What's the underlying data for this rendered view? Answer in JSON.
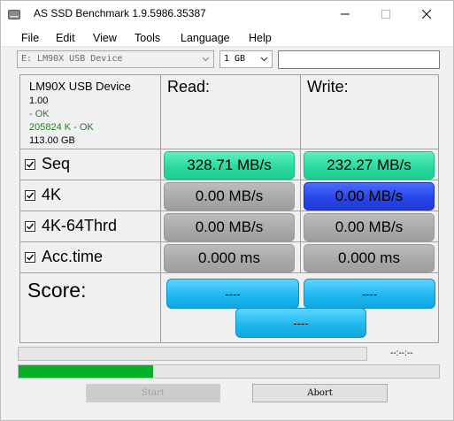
{
  "window": {
    "title": "AS SSD Benchmark 1.9.5986.35387"
  },
  "menu": [
    "File",
    "Edit",
    "View",
    "Tools",
    "Language",
    "Help"
  ],
  "toolbar": {
    "drive_select": "E: LM90X USB Device",
    "size_select": "1 GB",
    "text_field_value": ""
  },
  "device": {
    "name": "LM90X USB Device",
    "version": "1.00",
    "status1": " - OK",
    "status2": "205824 K - OK",
    "capacity": "113.00 GB"
  },
  "headers": {
    "read": "Read:",
    "write": "Write:"
  },
  "rows": [
    {
      "label": "Seq",
      "checked": true,
      "read": "328.71 MB/s",
      "write": "232.27 MB/s"
    },
    {
      "label": "4K",
      "checked": true,
      "read": "0.00 MB/s",
      "write": "0.00 MB/s"
    },
    {
      "label": "4K-64Thrd",
      "checked": true,
      "read": "0.00 MB/s",
      "write": "0.00 MB/s"
    },
    {
      "label": "Acc.time",
      "checked": true,
      "read": "0.000 ms",
      "write": "0.000 ms"
    }
  ],
  "score": {
    "label": "Score:",
    "read": "----",
    "write": "----",
    "total": "----"
  },
  "progress": {
    "timer": "--:--:--",
    "main_fraction": 0.32
  },
  "buttons": {
    "start": "Start",
    "abort": "Abort"
  },
  "colors": {
    "seq_cells": "#28d89c",
    "active_cell": "#2643e6",
    "idle_cells": "#a8a8a8",
    "score_boxes": "#1cb6ee",
    "progress_fill": "#06b025"
  }
}
